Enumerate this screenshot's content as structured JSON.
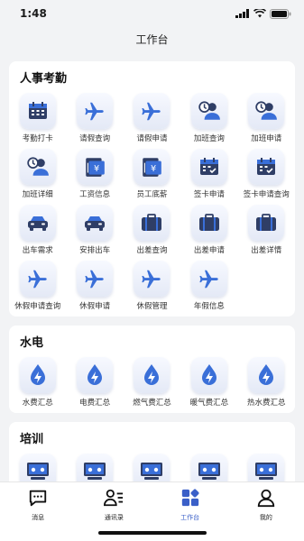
{
  "status": {
    "time": "1:48"
  },
  "nav": {
    "title": "工作台"
  },
  "sections": [
    {
      "title": "人事考勤",
      "items": [
        {
          "label": "考勤打卡",
          "icon": "calendar-icon"
        },
        {
          "label": "请假查询",
          "icon": "plane-icon"
        },
        {
          "label": "请假申请",
          "icon": "plane-icon"
        },
        {
          "label": "加班查询",
          "icon": "user-clock-icon"
        },
        {
          "label": "加班申请",
          "icon": "user-clock-icon"
        },
        {
          "label": "加班详细",
          "icon": "user-clock-icon"
        },
        {
          "label": "工资信息",
          "icon": "payslip-icon"
        },
        {
          "label": "员工底薪",
          "icon": "payslip-icon"
        },
        {
          "label": "签卡申请",
          "icon": "calendar-check-icon"
        },
        {
          "label": "签卡申请查询",
          "icon": "calendar-check-icon"
        },
        {
          "label": "出车需求",
          "icon": "car-icon"
        },
        {
          "label": "安排出车",
          "icon": "car-icon"
        },
        {
          "label": "出差查询",
          "icon": "suitcase-icon"
        },
        {
          "label": "出差申请",
          "icon": "suitcase-icon"
        },
        {
          "label": "出差详情",
          "icon": "suitcase-icon"
        },
        {
          "label": "休假申请查询",
          "icon": "plane-icon"
        },
        {
          "label": "休假申请",
          "icon": "plane-icon"
        },
        {
          "label": "休假管理",
          "icon": "plane-icon"
        },
        {
          "label": "年假信息",
          "icon": "plane-icon"
        }
      ]
    },
    {
      "title": "水电",
      "items": [
        {
          "label": "水费汇总",
          "icon": "drop-bolt-icon"
        },
        {
          "label": "电费汇总",
          "icon": "drop-bolt-icon"
        },
        {
          "label": "燃气费汇总",
          "icon": "drop-bolt-icon"
        },
        {
          "label": "暖气费汇总",
          "icon": "drop-bolt-icon"
        },
        {
          "label": "热水费汇总",
          "icon": "drop-bolt-icon"
        }
      ]
    },
    {
      "title": "培训",
      "items": [
        {
          "label": "",
          "icon": "training-icon"
        },
        {
          "label": "",
          "icon": "training-icon"
        },
        {
          "label": "",
          "icon": "training-icon"
        },
        {
          "label": "",
          "icon": "training-icon"
        },
        {
          "label": "",
          "icon": "training-icon"
        }
      ]
    }
  ],
  "tabbar": [
    {
      "label": "消息",
      "icon": "message-icon",
      "active": false
    },
    {
      "label": "通讯录",
      "icon": "contacts-icon",
      "active": false
    },
    {
      "label": "工作台",
      "icon": "workbench-icon",
      "active": true
    },
    {
      "label": "我的",
      "icon": "profile-icon",
      "active": false
    }
  ],
  "colors": {
    "accent": "#3a6fd8",
    "dark_icon": "#2f3e66"
  }
}
